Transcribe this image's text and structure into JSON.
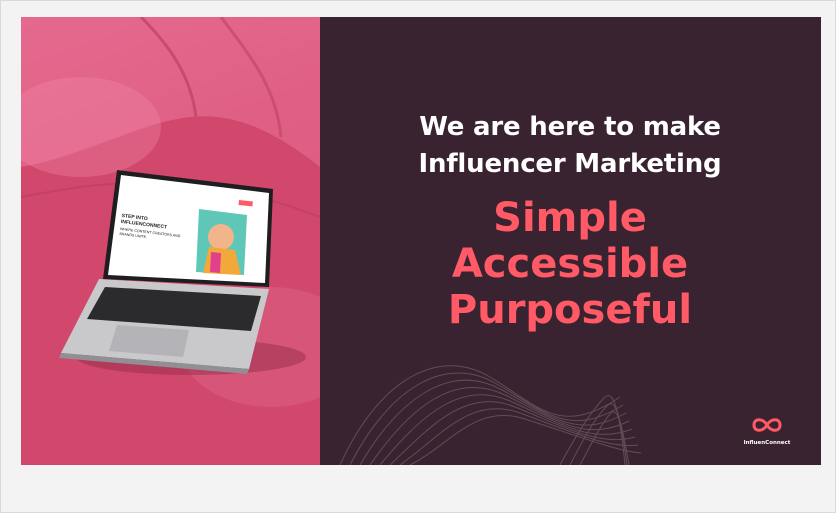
{
  "headline": {
    "line1": "We are here to make",
    "line2": "Influencer Marketing"
  },
  "words": [
    "Simple",
    "Accessible",
    "Purposeful"
  ],
  "brand": {
    "name": "InfluenConnect"
  },
  "laptop_screen": {
    "title_line1": "STEP INTO",
    "title_line2": "INFLUENCONNECT",
    "subtitle_line1": "WHERE CONTENT CREATORS AND",
    "subtitle_line2": "BRANDS UNITE."
  },
  "colors": {
    "panel_bg": "#3a2330",
    "accent": "#ff5a66",
    "pink_bg": "#d5496f",
    "white": "#ffffff"
  }
}
